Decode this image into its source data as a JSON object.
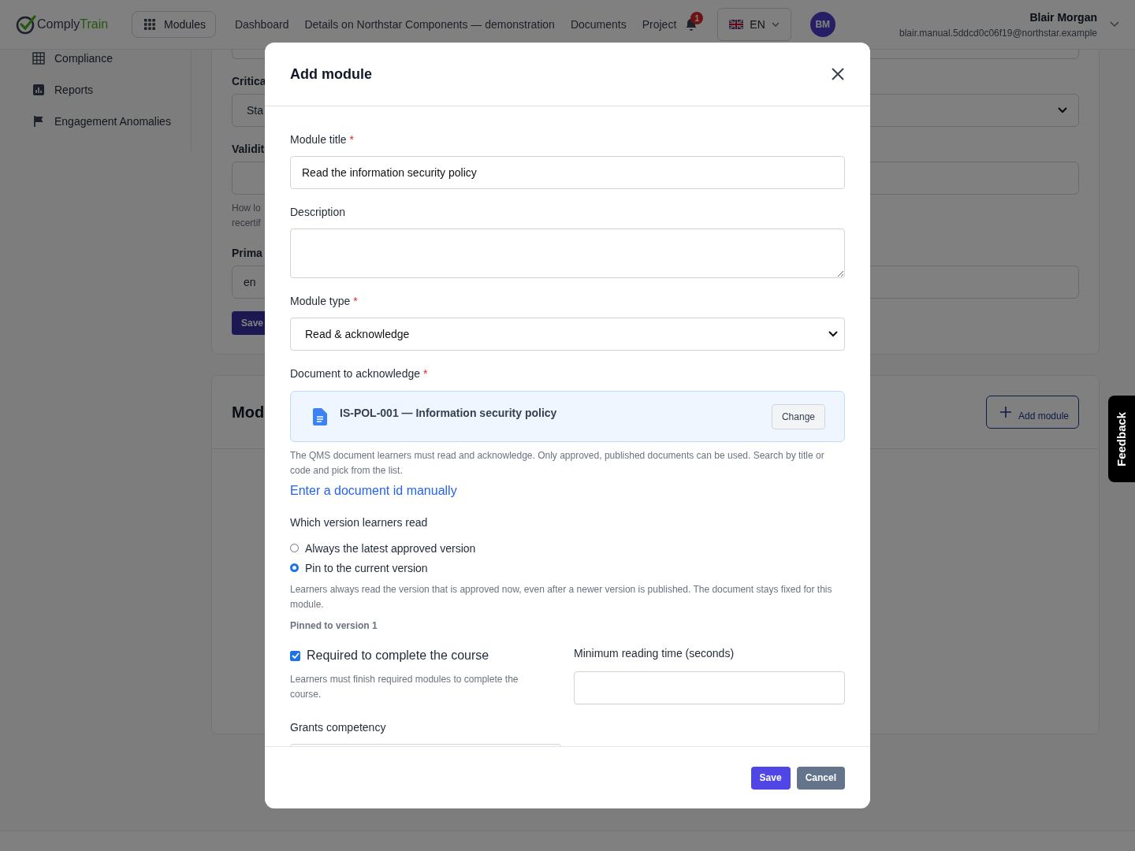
{
  "header": {
    "logo": {
      "first": "Comply",
      "second": "Train"
    },
    "modules_button": "Modules",
    "nav": [
      "Dashboard",
      "Details on Northstar Components — demonstration",
      "Documents",
      "Project"
    ],
    "notification_count": "1",
    "language": "EN",
    "user": {
      "initials": "BM",
      "name": "Blair Morgan",
      "email": "blair.manual.5ddcd0c06f19@northstar.example"
    }
  },
  "sidebar": {
    "items": [
      {
        "label": "Compliance",
        "kind": "grid"
      },
      {
        "label": "Reports",
        "kind": "chart"
      },
      {
        "label": "Engagement Anomalies",
        "kind": "flag"
      }
    ]
  },
  "settings_card": {
    "criticality_label": "Critica",
    "criticality_value": "Sta",
    "validity_label": "Validit",
    "validity_hint": [
      "How lo",
      "recertif"
    ],
    "language_label": "Prima",
    "language_value": "en",
    "save_button": "Save"
  },
  "modules_card": {
    "title": "Mod",
    "add_button": "Add module"
  },
  "modal": {
    "title": "Add module",
    "module_title": {
      "label": "Module title",
      "required_mark": "*",
      "value": "Read the information security policy"
    },
    "description": {
      "label": "Description"
    },
    "module_type": {
      "label": "Module type",
      "required_mark": "*",
      "value": "Read & acknowledge"
    },
    "document": {
      "label": "Document to acknowledge",
      "required_mark": "*",
      "selected_document": "IS-POL-001 — Information security policy",
      "change_button": "Change",
      "hint": "The QMS document learners must read and acknowledge. Only approved, published documents can be used. Search by title or code and pick from the list.",
      "manual_link": "Enter a document id manually"
    },
    "version": {
      "label": "Which version learners read",
      "options": [
        {
          "label": "Always the latest approved version",
          "selected": false
        },
        {
          "label": "Pin to the current version",
          "selected": true
        }
      ],
      "hint": "Learners always read the version that is approved now, even after a newer version is published. The document stays fixed for this module.",
      "pinned_note": "Pinned to version 1"
    },
    "required_checkbox": {
      "label": "Required to complete the course",
      "checked": true,
      "hint": "Learners must finish required modules to complete the course."
    },
    "min_reading_time": {
      "label": "Minimum reading time (seconds)"
    },
    "grants_competency": {
      "label": "Grants competency"
    },
    "save_button": "Save",
    "cancel_button": "Cancel"
  },
  "feedback_tab": "Feedback"
}
